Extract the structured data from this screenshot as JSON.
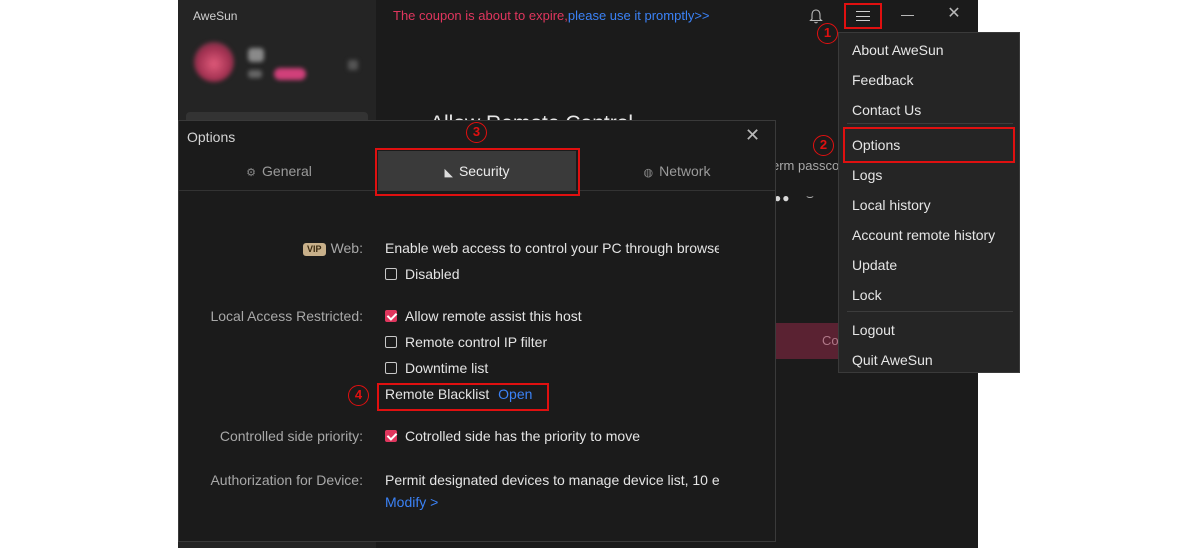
{
  "app": {
    "name": "AweSun",
    "banner_red": "The coupon is about to expire,",
    "banner_blue": "please use it promptly>>",
    "bg_title": "Allow Remote Control",
    "bg_passcode": "erm passco",
    "bg_dots": "●●",
    "bg_button": "Co",
    "close_glyph": "✕"
  },
  "steps": {
    "s1": "1",
    "s2": "2",
    "s3": "3",
    "s4": "4"
  },
  "options": {
    "title": "Options",
    "close_glyph": "✕",
    "tabs": [
      {
        "label": "General",
        "icon": "gear-icon"
      },
      {
        "label": "Security",
        "icon": "shield-icon"
      },
      {
        "label": "Network",
        "icon": "globe-icon"
      }
    ],
    "web": {
      "vip": "VIP",
      "label": "Web:",
      "desc": "Enable web access to control your PC through browse",
      "disabled_label": "Disabled"
    },
    "local": {
      "label": "Local Access Restricted:",
      "allow": "Allow remote assist this host",
      "ip_filter": "Remote control IP filter",
      "downtime": "Downtime list",
      "blacklist": "Remote Blacklist",
      "open": "Open"
    },
    "priority": {
      "label": "Controlled side priority:",
      "value": "Cotrolled side has the priority to move"
    },
    "auth": {
      "label": "Authorization for Device:",
      "desc": "Permit designated devices to manage device list, 10 ec",
      "modify": "Modify >"
    }
  },
  "menu": {
    "items": [
      "About AweSun",
      "Feedback",
      "Contact Us",
      "Options",
      "Logs",
      "Local history",
      "Account remote history",
      "Update",
      "Lock",
      "Logout",
      "Quit AweSun"
    ]
  },
  "colors": {
    "accent": "#e0365e",
    "link": "#3b82f6",
    "highlight": "#e01010"
  }
}
